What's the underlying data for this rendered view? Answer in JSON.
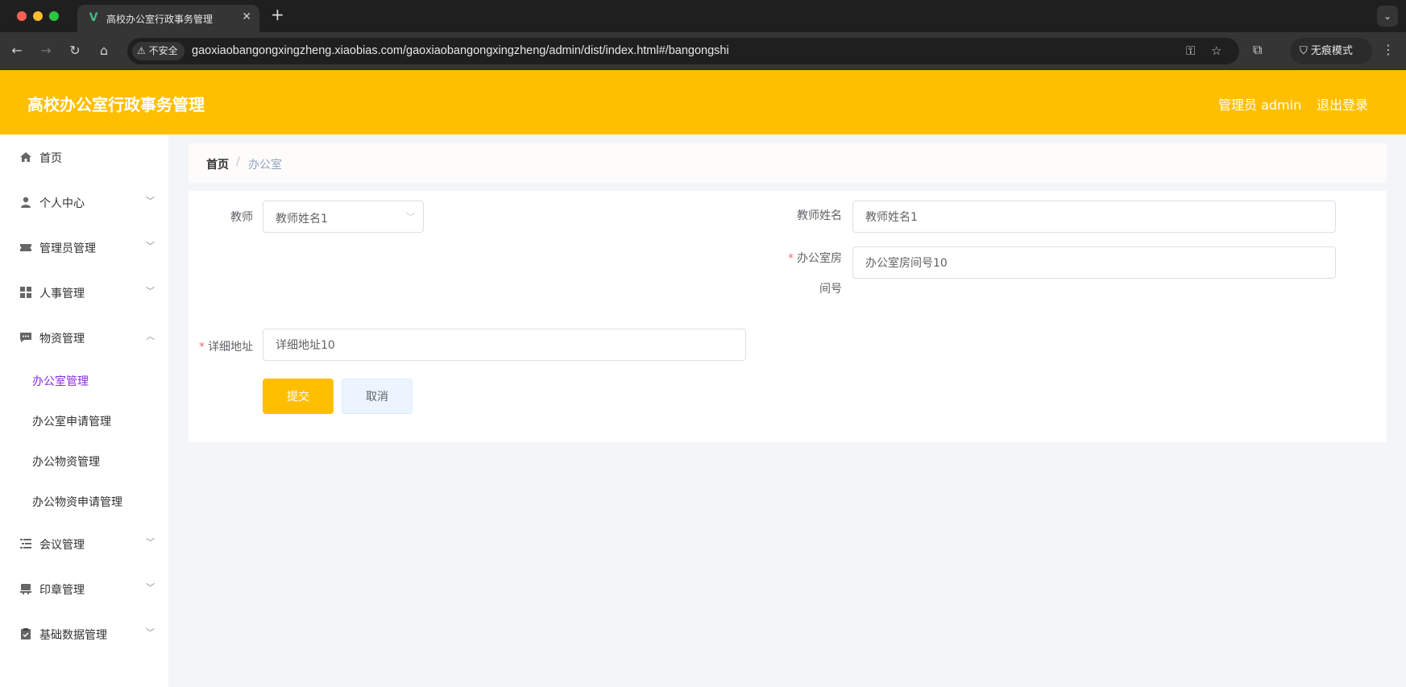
{
  "browser": {
    "tab_title": "高校办公室行政事务管理",
    "tab_favicon": "V",
    "insecure_label": "不安全",
    "url": "gaoxiaobangongxingzheng.xiaobias.com/gaoxiaobangongxingzheng/admin/dist/index.html#/bangongshi",
    "incognito_label": "无痕模式"
  },
  "header": {
    "title": "高校办公室行政事务管理",
    "user": "管理员 admin",
    "logout": "退出登录",
    "color": "#ffbf00"
  },
  "sidebar": {
    "items": [
      {
        "label": "首页",
        "icon": "home-icon"
      },
      {
        "label": "个人中心",
        "icon": "user-icon",
        "arrow": "down"
      },
      {
        "label": "管理员管理",
        "icon": "ticket-icon",
        "arrow": "down"
      },
      {
        "label": "人事管理",
        "icon": "grid-icon",
        "arrow": "down"
      },
      {
        "label": "物资管理",
        "icon": "chat-icon",
        "arrow": "up"
      },
      {
        "label": "会议管理",
        "icon": "list-icon",
        "arrow": "down"
      },
      {
        "label": "印章管理",
        "icon": "stamp-icon",
        "arrow": "down"
      },
      {
        "label": "基础数据管理",
        "icon": "clipboard-icon",
        "arrow": "down"
      }
    ],
    "subitems": [
      {
        "label": "办公室管理",
        "active": true
      },
      {
        "label": "办公室申请管理"
      },
      {
        "label": "办公物资管理"
      },
      {
        "label": "办公物资申请管理"
      }
    ],
    "active_color": "#8a2be2"
  },
  "breadcrumb": {
    "home": "首页",
    "separator": "/",
    "current": "办公室"
  },
  "form": {
    "teacher_label": "教师",
    "teacher_value": "教师姓名1",
    "teacher_name_label": "教师姓名",
    "teacher_name_value": "教师姓名1",
    "room_label_line1": "办公室房",
    "room_label_line2": "间号",
    "room_value": "办公室房间号10",
    "address_label": "详细地址",
    "address_value": "详细地址10",
    "required_mark": "*",
    "submit": "提交",
    "cancel": "取消"
  }
}
